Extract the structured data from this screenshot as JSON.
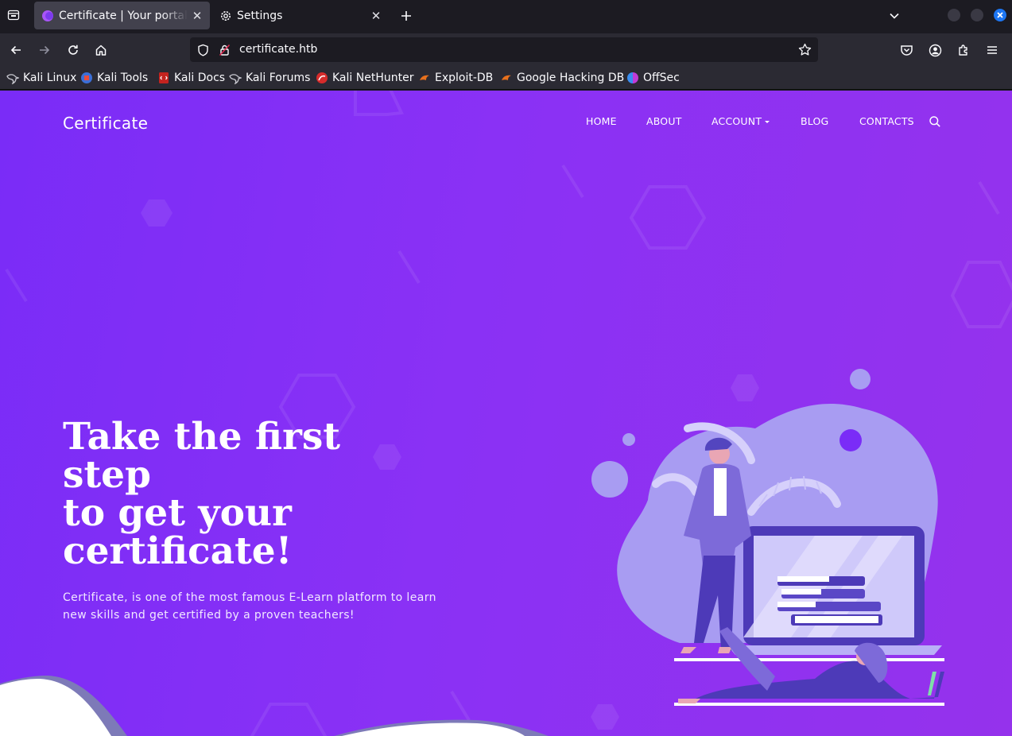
{
  "browser": {
    "tabs": [
      {
        "title": "Certificate | Your portal for certification",
        "active": true
      },
      {
        "title": "Settings",
        "active": false
      }
    ],
    "url": "certificate.htb",
    "bookmarks": [
      {
        "label": "Kali Linux",
        "icon": "kali-dragon-icon"
      },
      {
        "label": "Kali Tools",
        "icon": "kali-tools-icon"
      },
      {
        "label": "Kali Docs",
        "icon": "kali-docs-icon"
      },
      {
        "label": "Kali Forums",
        "icon": "kali-dragon-icon"
      },
      {
        "label": "Kali NetHunter",
        "icon": "nethunter-icon"
      },
      {
        "label": "Exploit-DB",
        "icon": "exploit-db-icon"
      },
      {
        "label": "Google Hacking DB",
        "icon": "exploit-db-icon"
      },
      {
        "label": "OffSec",
        "icon": "offsec-icon"
      }
    ],
    "accent": "#1d76f2"
  },
  "site": {
    "brand": "Certificate",
    "nav": [
      "HOME",
      "ABOUT",
      "ACCOUNT",
      "BLOG",
      "CONTACTS"
    ],
    "hero": {
      "title_lines": [
        "Take the first",
        "step",
        "to get your",
        "certificate!"
      ],
      "subtitle": "Certificate, is one of the most famous E-Learn platform to learn new skills and get certified by a proven teachers!"
    },
    "colors": {
      "background": "#8a31f5",
      "text": "#ffffff"
    }
  }
}
